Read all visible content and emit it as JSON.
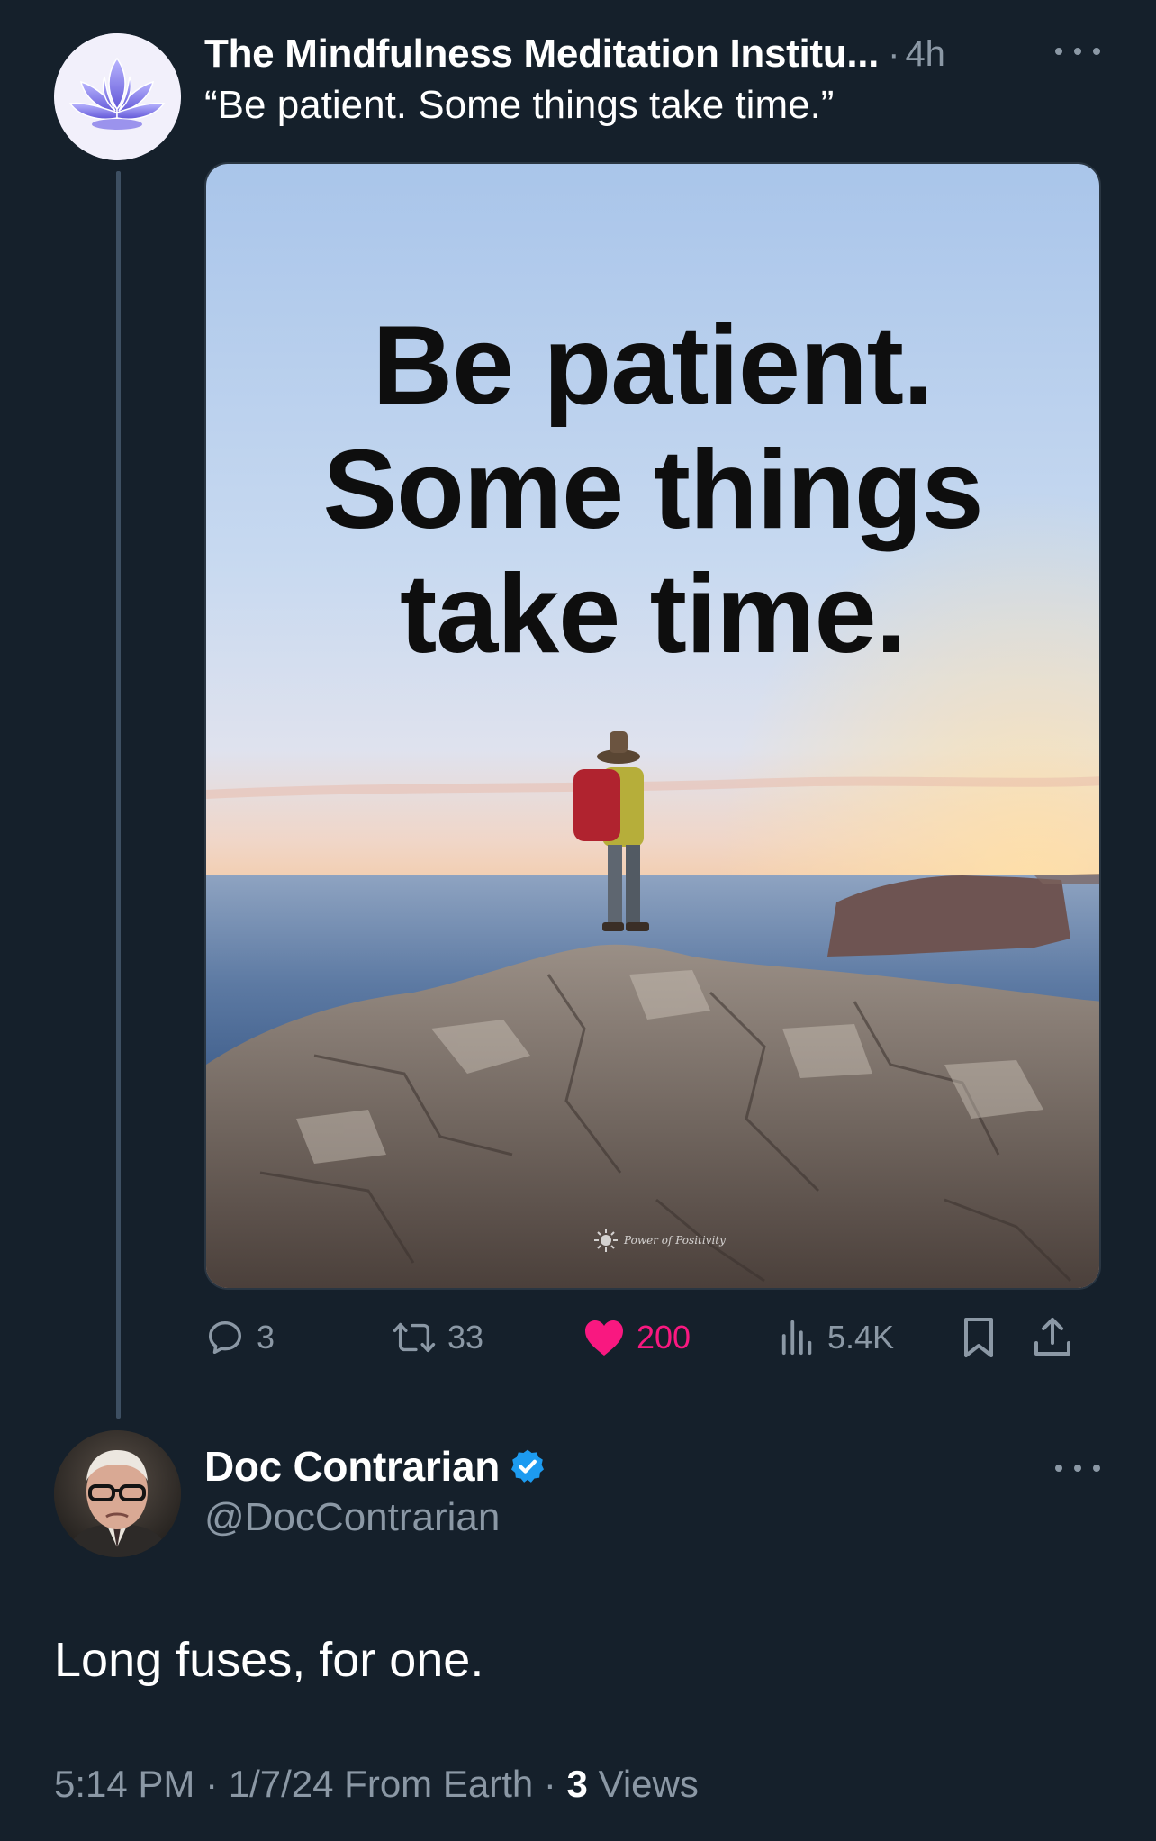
{
  "tweet": {
    "author": "The Mindfulness Meditation Institu...",
    "separator": "·",
    "time": "4h",
    "text": "“Be patient. Some things take time.”",
    "media": {
      "quote_lines": [
        "Be patient.",
        "Some things",
        "take time."
      ],
      "watermark": "Power of Positivity"
    },
    "actions": {
      "replies": "3",
      "reposts": "33",
      "likes": "200",
      "views": "5.4K"
    }
  },
  "reply": {
    "author": "Doc Contrarian",
    "handle": "@DocContrarian",
    "text": "Long fuses, for one.",
    "meta_prefix": "5:14 PM · 1/7/24 From Earth · ",
    "views_count": "3",
    "views_label": " Views"
  },
  "colors": {
    "background": "#15202b",
    "secondary_text": "#8b98a5",
    "like": "#f91880",
    "verified": "#1d9bf0"
  },
  "icons": {
    "reply": "comment-icon",
    "repost": "retweet-icon",
    "like": "heart-icon",
    "views": "bar-chart-icon",
    "bookmark": "bookmark-icon",
    "share": "share-icon",
    "more": "more-dots-icon",
    "verified": "verified-badge-icon"
  }
}
